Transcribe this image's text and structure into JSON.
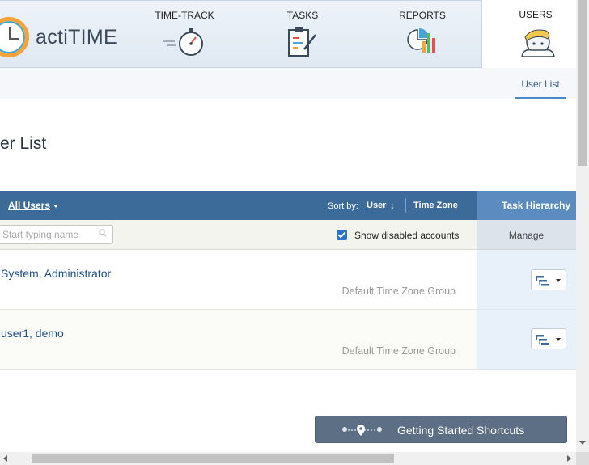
{
  "app": {
    "logo_text": "actiTIME"
  },
  "nav": {
    "items": [
      {
        "label": "TIME-TRACK",
        "icon": "stopwatch-icon"
      },
      {
        "label": "TASKS",
        "icon": "clipboard-tasks-icon"
      },
      {
        "label": "REPORTS",
        "icon": "reports-chart-icon"
      },
      {
        "label": "USERS",
        "icon": "users-avatar-icon",
        "active": true
      }
    ]
  },
  "subnav": {
    "user_list": "User List"
  },
  "page": {
    "title": "er List"
  },
  "table": {
    "filter_label": "All Users",
    "sort_by_label": "Sort by:",
    "sort_user": "User",
    "sort_timezone": "Time Zone",
    "task_hierarchy": "Task  Hierarchy",
    "search_placeholder": "Start typing name",
    "show_disabled_label": "Show disabled accounts",
    "show_disabled_checked": true,
    "manage_label": "Manage",
    "rows": [
      {
        "name": "System, Administrator",
        "timezone_group": "Default Time Zone Group"
      },
      {
        "name": "user1, demo",
        "timezone_group": "Default Time Zone Group"
      }
    ]
  },
  "shortcuts": {
    "label": "Getting Started Shortcuts"
  },
  "colors": {
    "header_blue": "#3d6b99",
    "link_blue": "#23518b",
    "shortcut_bg": "#5d6f85"
  }
}
